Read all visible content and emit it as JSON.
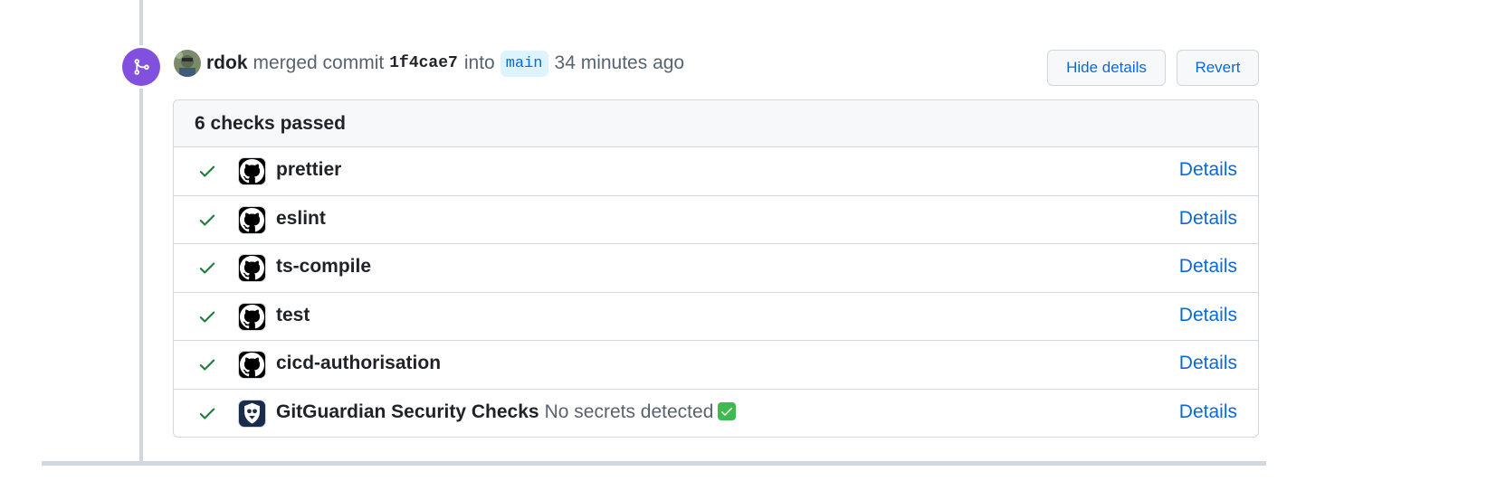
{
  "event": {
    "actor": "rdok",
    "action": "merged commit",
    "commit_sha": "1f4cae7",
    "into_text": "into",
    "branch": "main",
    "time_ago": "34 minutes ago"
  },
  "buttons": {
    "hide_details": "Hide details",
    "revert": "Revert"
  },
  "checks": {
    "summary": "6 checks passed",
    "details_label": "Details",
    "items": [
      {
        "name": "prettier",
        "description": "",
        "app_icon": "github-icon",
        "status": "success"
      },
      {
        "name": "eslint",
        "description": "",
        "app_icon": "github-icon",
        "status": "success"
      },
      {
        "name": "ts-compile",
        "description": "",
        "app_icon": "github-icon",
        "status": "success"
      },
      {
        "name": "test",
        "description": "",
        "app_icon": "github-icon",
        "status": "success"
      },
      {
        "name": "cicd-authorisation",
        "description": "",
        "app_icon": "github-icon",
        "status": "success"
      },
      {
        "name": "GitGuardian Security Checks",
        "description": "No secrets detected",
        "app_icon": "gitguardian-icon",
        "status": "success"
      }
    ]
  },
  "colors": {
    "merged_purple": "#8250df",
    "success_green": "#1a7f37",
    "link_blue": "#0969da",
    "border_gray": "#d0d7de"
  }
}
